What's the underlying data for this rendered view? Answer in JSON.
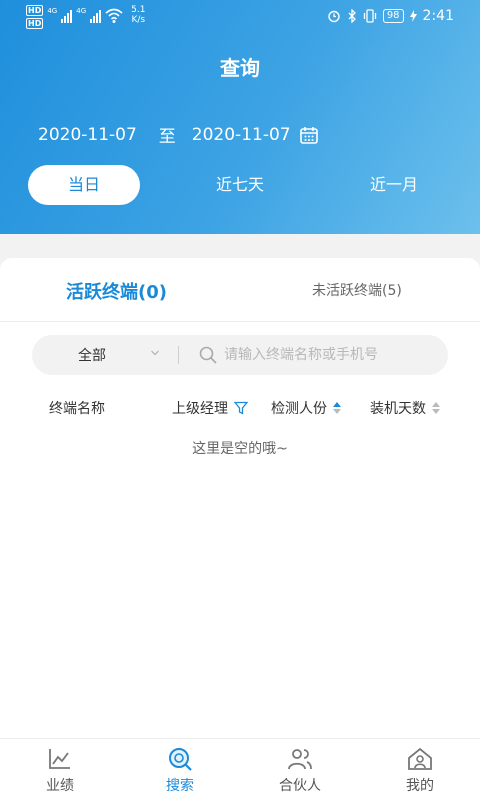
{
  "status_bar": {
    "hd1": "HD",
    "hd2": "HD",
    "net1": "4G",
    "net2": "4G",
    "speed_value": "5.1",
    "speed_unit": "K/s",
    "battery": "98",
    "time": "2:41"
  },
  "header": {
    "title": "查询",
    "start_date": "2020-11-07",
    "to_label": "至",
    "end_date": "2020-11-07",
    "ranges": [
      {
        "label": "当日",
        "active": true
      },
      {
        "label": "近七天",
        "active": false
      },
      {
        "label": "近一月",
        "active": false
      }
    ]
  },
  "tabs": {
    "active": "活跃终端(0)",
    "inactive": "未活跃终端(5)"
  },
  "filter": {
    "select_value": "全部",
    "search_placeholder": "请输入终端名称或手机号"
  },
  "table": {
    "columns": [
      "终端名称",
      "上级经理",
      "检测人份",
      "装机天数"
    ],
    "rows": []
  },
  "empty_text": "这里是空的哦~",
  "tabbar": {
    "items": [
      {
        "label": "业绩",
        "icon": "chart-icon",
        "active": false
      },
      {
        "label": "搜索",
        "icon": "search-icon",
        "active": true
      },
      {
        "label": "合伙人",
        "icon": "partners-icon",
        "active": false
      },
      {
        "label": "我的",
        "icon": "home-profile-icon",
        "active": false
      }
    ]
  },
  "colors": {
    "accent": "#1a8ad8",
    "header_gradient_start": "#1f8fdc",
    "header_gradient_end": "#6cc0ec"
  }
}
